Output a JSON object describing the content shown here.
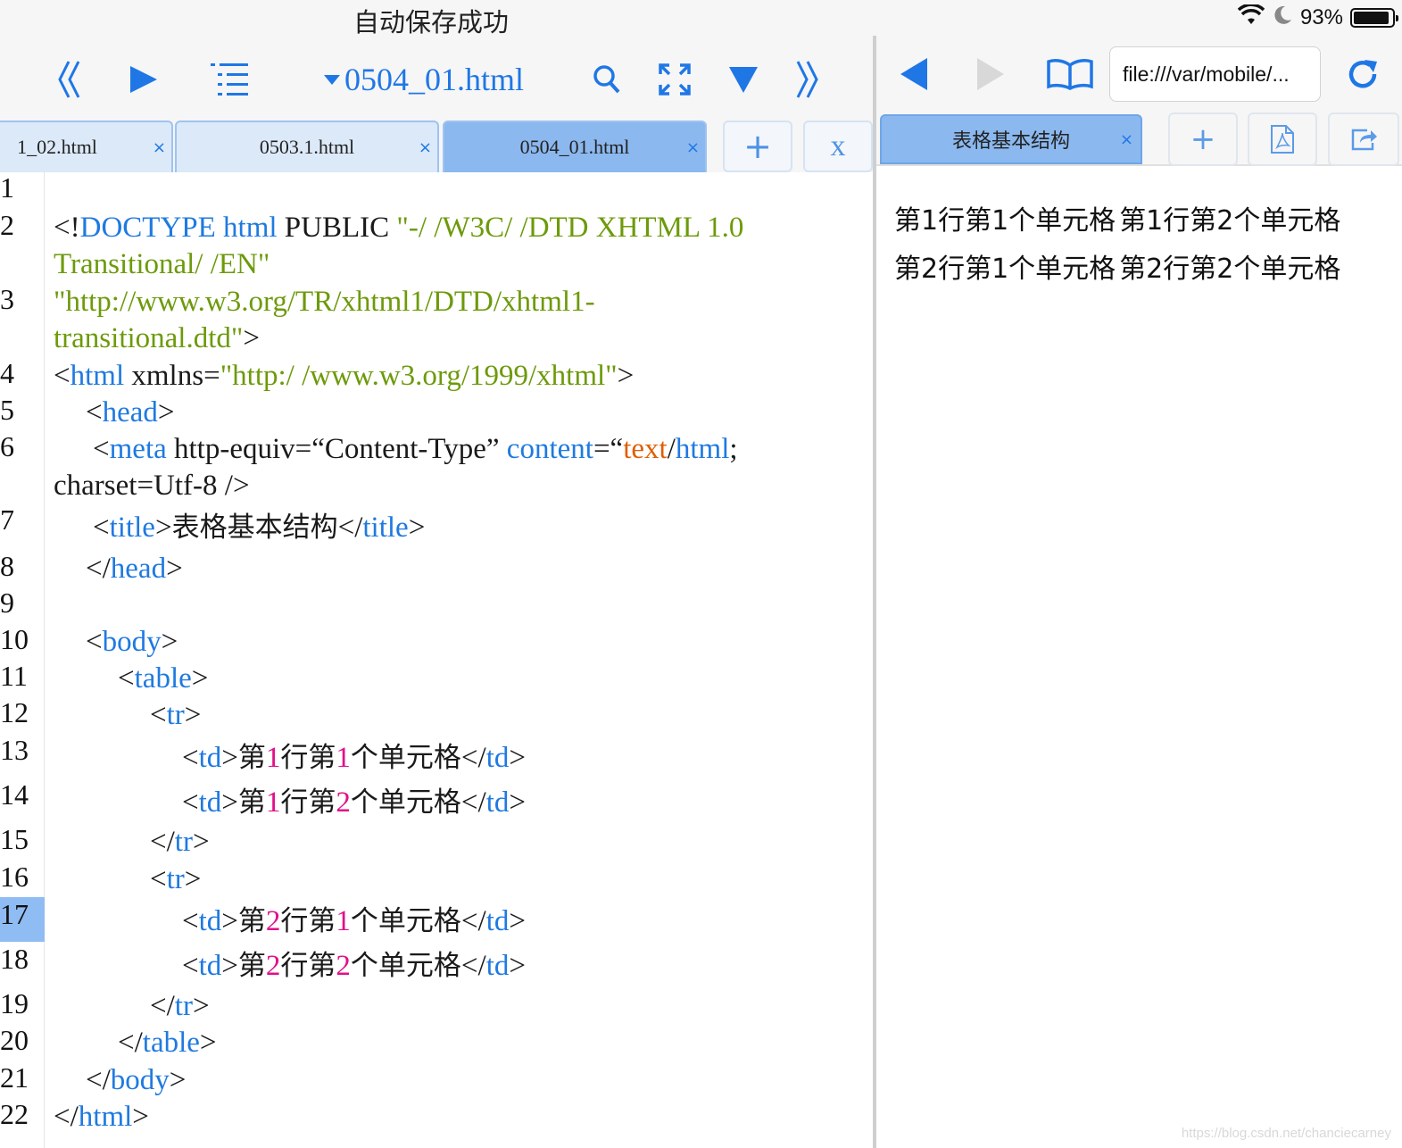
{
  "status_bar": {
    "save_message": "自动保存成功",
    "battery": "93%",
    "battery_level": 0.93
  },
  "editor": {
    "toolbar": {
      "file_title": "0504_01.html"
    },
    "tabs": [
      {
        "label": "1_02.html",
        "active": false
      },
      {
        "label": "0503.1.html",
        "active": false
      },
      {
        "label": "0504_01.html",
        "active": true
      }
    ],
    "close_tab_label": "×",
    "add_tab_label": "+",
    "close_all_label": "x",
    "current_line": 17,
    "line_numbers": [
      "1",
      "2",
      "3",
      "4",
      "5",
      "6",
      "7",
      "8",
      "9",
      "10",
      "11",
      "12",
      "13",
      "14",
      "15",
      "16",
      "17",
      "18",
      "19",
      "20",
      "21",
      "22"
    ]
  },
  "code": {
    "l2a": {
      "p1": "<!",
      "k1": "DOCTYPE html",
      "p2": " PUBLIC ",
      "s1": "\"-/ /W3C/ /DTD XHTML 1.0"
    },
    "l2b": {
      "s1": "Transitional/ /EN\""
    },
    "l3a": {
      "s1": "\"http://www.w3.org/TR/xhtml1/DTD/xhtml1-"
    },
    "l3b": {
      "s1": "transitional.dtd\"",
      "p1": ">"
    },
    "l4": {
      "p1": "<",
      "k1": "html",
      "p2": " xmlns=",
      "s1": "\"http:/ /www.w3.org/1999/xhtml\"",
      "p3": ">"
    },
    "l5": {
      "p1": "<",
      "k1": "head",
      "p2": ">"
    },
    "l6a": {
      "p1": "<",
      "k1": "meta",
      "p2": " http-equiv=“Content-Type” ",
      "k2": "content",
      "p3": "=“",
      "o1": "text",
      "p4": "/",
      "k3": "html",
      "p5": ";"
    },
    "l6b": {
      "p1": "charset=Utf-8 />"
    },
    "l7": {
      "p1": "<",
      "k1": "title",
      "p2": ">",
      "t1": "表格基本结构",
      "p3": "</",
      "k2": "title",
      "p4": ">"
    },
    "l8": {
      "p1": "</",
      "k1": "head",
      "p2": ">"
    },
    "l10": {
      "p1": "<",
      "k1": "body",
      "p2": ">"
    },
    "l11": {
      "p1": "<",
      "k1": "table",
      "p2": ">"
    },
    "l12": {
      "p1": "<",
      "k1": "tr",
      "p2": ">"
    },
    "l13": {
      "p1": "<",
      "k1": "td",
      "p2": ">",
      "c1": "第",
      "n1": "1",
      "c2": "行第",
      "n2": "1",
      "c3": "个单元格",
      "p3": "</",
      "k2": "td",
      "p4": ">"
    },
    "l14": {
      "p1": "<",
      "k1": "td",
      "p2": ">",
      "c1": "第",
      "n1": "1",
      "c2": "行第",
      "n2": "2",
      "c3": "个单元格",
      "p3": "</",
      "k2": "td",
      "p4": ">"
    },
    "l15": {
      "p1": "</",
      "k1": "tr",
      "p2": ">"
    },
    "l16": {
      "p1": "<",
      "k1": "tr",
      "p2": ">"
    },
    "l17": {
      "p1": "<",
      "k1": "td",
      "p2": ">",
      "c1": "第",
      "n1": "2",
      "c2": "行第",
      "n2": "1",
      "c3": "个单元格",
      "p3": "</",
      "k2": "td",
      "p4": ">"
    },
    "l18": {
      "p1": "<",
      "k1": "td",
      "p2": ">",
      "c1": "第",
      "n1": "2",
      "c2": "行第",
      "n2": "2",
      "c3": "个单元格",
      "p3": "</",
      "k2": "td",
      "p4": ">"
    },
    "l19": {
      "p1": "</",
      "k1": "tr",
      "p2": ">"
    },
    "l20": {
      "p1": "</",
      "k1": "table",
      "p2": ">"
    },
    "l21": {
      "p1": "</",
      "k1": "body",
      "p2": ">"
    },
    "l22": {
      "p1": "</",
      "k1": "html",
      "p2": ">"
    }
  },
  "preview": {
    "url": "file:///var/mobile/...",
    "tab_label": "表格基本结构",
    "close_tab_label": "×",
    "add_tab_label": "+",
    "table_rows": [
      [
        "第1行第1个单元格",
        "第1行第2个单元格"
      ],
      [
        "第2行第1个单元格",
        "第2行第2个单元格"
      ]
    ]
  },
  "watermark": "https://blog.csdn.net/chanciecarney",
  "colors": {
    "accent": "#1f77e6",
    "keyword": "#1f7ae0",
    "string": "#6d9a0a",
    "attr_value": "#e05e00",
    "number": "#e0108a",
    "active_tab": "#8bb8ee"
  },
  "icons": {
    "editor_toolbar": [
      "double-left-chevron-icon",
      "play-icon",
      "outline-list-icon",
      "dropdown-triangle-icon",
      "search-icon",
      "fullscreen-icon",
      "down-triangle-icon",
      "double-right-chevron-icon"
    ],
    "preview_toolbar": [
      "back-arrow-icon",
      "forward-arrow-icon",
      "bookmarks-book-icon",
      "reload-icon",
      "pdf-icon",
      "share-icon"
    ],
    "status": [
      "wifi-icon",
      "moon-icon",
      "battery-icon"
    ]
  }
}
